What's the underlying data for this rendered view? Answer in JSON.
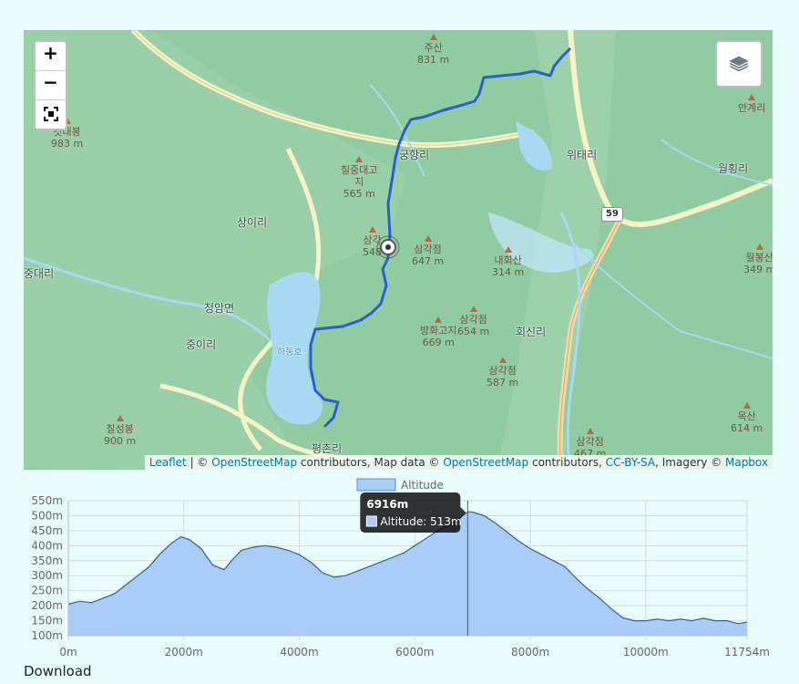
{
  "map": {
    "zoom_in_label": "+",
    "zoom_out_label": "−",
    "fullscreen_icon": "fullscreen-icon",
    "layers_icon": "layers-icon",
    "attribution": {
      "leaflet": "Leaflet",
      "sep": " | © ",
      "osm1": "OpenStreetMap",
      "mid1": " contributors, Map data © ",
      "osm2": "OpenStreetMap",
      "mid2": " contributors, ",
      "license": "CC-BY-SA",
      "mid3": ", Imagery © ",
      "mapbox": "Mapbox"
    },
    "peaks": [
      {
        "name": "주산",
        "elev": "831 m"
      },
      {
        "name": "갓대봉",
        "elev": "983 m"
      },
      {
        "name": "칠중대고\n지",
        "elev": "565 m"
      },
      {
        "name": "삼각",
        "elev": "548"
      },
      {
        "name": "삼각점",
        "elev": "647 m"
      },
      {
        "name": "내회산",
        "elev": "314 m"
      },
      {
        "name": "삼각점",
        "elev": "654 m"
      },
      {
        "name": "방화고지",
        "elev": "669 m"
      },
      {
        "name": "삼각점",
        "elev": "587 m"
      },
      {
        "name": "칠성봉",
        "elev": "900 m"
      },
      {
        "name": "안계리",
        "elev": ""
      },
      {
        "name": "월봉산",
        "elev": "349 m"
      },
      {
        "name": "옥산",
        "elev": "614 m"
      },
      {
        "name": "삼각점",
        "elev": "467 m"
      }
    ],
    "places": [
      "궁항리",
      "위태리",
      "월횡리",
      "상이리",
      "중대리",
      "청암면",
      "중이리",
      "회신리",
      "평촌리"
    ],
    "road_shield": "59",
    "lake_label": "하동호"
  },
  "chart_data": {
    "type": "area",
    "legend": "Altitude",
    "x_unit": "m",
    "y_unit": "m",
    "xlim": [
      0,
      11754
    ],
    "ylim": [
      100,
      550
    ],
    "x_ticks": [
      "0m",
      "2000m",
      "4000m",
      "6000m",
      "8000m",
      "10000m",
      "11754m"
    ],
    "y_ticks": [
      "550m",
      "500m",
      "450m",
      "400m",
      "350m",
      "300m",
      "250m",
      "200m",
      "150m",
      "100m"
    ],
    "x": [
      0,
      200,
      400,
      600,
      800,
      1000,
      1200,
      1400,
      1600,
      1800,
      1950,
      2100,
      2300,
      2500,
      2700,
      2850,
      3000,
      3200,
      3400,
      3600,
      3800,
      4000,
      4200,
      4400,
      4600,
      4800,
      5000,
      5200,
      5400,
      5600,
      5800,
      6000,
      6200,
      6400,
      6600,
      6800,
      6916,
      7000,
      7200,
      7400,
      7600,
      7800,
      8000,
      8200,
      8400,
      8600,
      8800,
      9000,
      9200,
      9400,
      9600,
      9800,
      10000,
      10200,
      10400,
      10600,
      10800,
      11000,
      11200,
      11400,
      11600,
      11754
    ],
    "y": [
      205,
      215,
      210,
      225,
      240,
      270,
      300,
      330,
      375,
      410,
      430,
      420,
      390,
      335,
      320,
      355,
      385,
      395,
      400,
      395,
      385,
      370,
      345,
      310,
      295,
      300,
      315,
      330,
      345,
      360,
      375,
      400,
      425,
      450,
      470,
      495,
      513,
      512,
      500,
      475,
      445,
      415,
      390,
      370,
      350,
      330,
      290,
      255,
      225,
      190,
      160,
      150,
      150,
      155,
      150,
      155,
      150,
      158,
      150,
      150,
      140,
      145
    ],
    "tooltip": {
      "title": "6916m",
      "label": "Altitude: 513m",
      "x": 6916
    },
    "colors": {
      "fill": "#aacdf8",
      "line": "#34618f",
      "grid": "#d9d9d9"
    }
  },
  "download_label": "Download"
}
